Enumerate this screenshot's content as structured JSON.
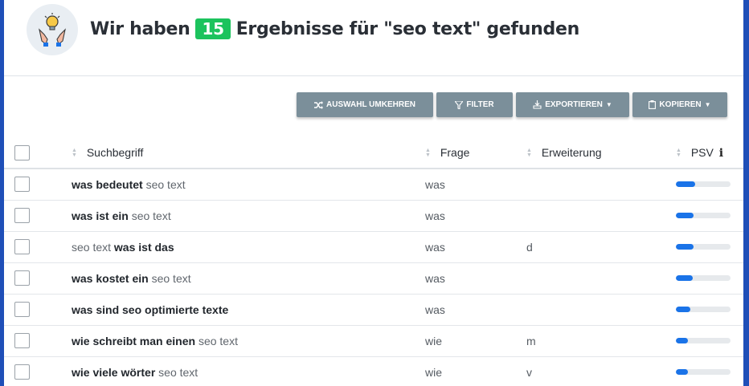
{
  "header": {
    "title_before": "Wir haben",
    "count": "15",
    "title_after": "Ergebnisse für \"seo text\" gefunden",
    "logo_icon": "lightbulb-hands-icon"
  },
  "toolbar": {
    "invert_label": "AUSWAHL UMKEHREN",
    "filter_label": "FILTER",
    "export_label": "EXPORTIEREN",
    "copy_label": "KOPIEREN",
    "button_color": "#7b8f9a"
  },
  "table": {
    "columns": {
      "term": "Suchbegriff",
      "frage": "Frage",
      "erweiterung": "Erweiterung",
      "psv": "PSV"
    },
    "rows": [
      {
        "parts": [
          {
            "text": "was bedeutet",
            "bold": true
          },
          {
            "text": " seo text",
            "bold": false
          }
        ],
        "frage": "was",
        "erweiterung": "",
        "psv": 0.36
      },
      {
        "parts": [
          {
            "text": "was ist ein",
            "bold": true
          },
          {
            "text": " seo text",
            "bold": false
          }
        ],
        "frage": "was",
        "erweiterung": "",
        "psv": 0.32
      },
      {
        "parts": [
          {
            "text": "seo text ",
            "bold": false
          },
          {
            "text": "was ist das",
            "bold": true
          }
        ],
        "frage": "was",
        "erweiterung": "d",
        "psv": 0.32
      },
      {
        "parts": [
          {
            "text": "was kostet ein",
            "bold": true
          },
          {
            "text": " seo text",
            "bold": false
          }
        ],
        "frage": "was",
        "erweiterung": "",
        "psv": 0.31
      },
      {
        "parts": [
          {
            "text": "was sind seo optimierte texte",
            "bold": true
          }
        ],
        "frage": "was",
        "erweiterung": "",
        "psv": 0.27
      },
      {
        "parts": [
          {
            "text": "wie schreibt man einen",
            "bold": true
          },
          {
            "text": " seo text",
            "bold": false
          }
        ],
        "frage": "wie",
        "erweiterung": "m",
        "psv": 0.22
      },
      {
        "parts": [
          {
            "text": "wie viele wörter",
            "bold": true
          },
          {
            "text": " seo text",
            "bold": false
          }
        ],
        "frage": "wie",
        "erweiterung": "v",
        "psv": 0.22
      }
    ]
  }
}
